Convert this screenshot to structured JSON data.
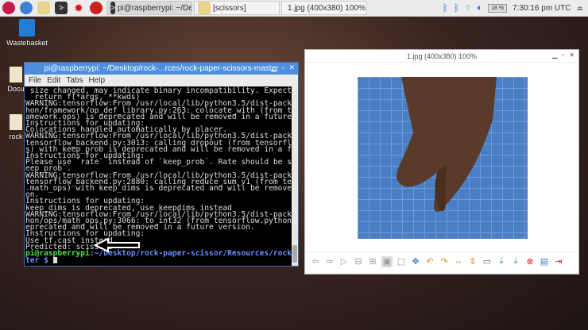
{
  "taskbar": {
    "tasks": [
      {
        "label": "pi@raspberrypi: ~/De..."
      },
      {
        "label": "[scissors]"
      },
      {
        "label": "1.jpg (400x380) 100%"
      }
    ],
    "cpu": "18 %",
    "clock": "7:30:16 pm UTC"
  },
  "desktop": {
    "icons": [
      {
        "label": "Wastebasket"
      },
      {
        "label": "Docu"
      },
      {
        "label": "rock"
      }
    ]
  },
  "terminal": {
    "title": "pi@raspberrypi: ~/Desktop/rock-...rces/rock-paper-scissors-master",
    "menu": [
      "File",
      "Edit",
      "Tabs",
      "Help"
    ],
    "lines": [
      " size changed, may indicate binary incompatibility. Expected 432, got 412",
      "  return f(*args, **kwds)",
      "WARNING:tensorflow:From /usr/local/lib/python3.5/dist-packages/tensorflow/pyt",
      "hon/framework/op_def_library.py:263: colocate_with (from tensorflow.python.fr",
      "amework.ops) is deprecated and will be removed in a future version.",
      "Instructions for updating:",
      "Colocations handled automatically by placer.",
      "WARNING:tensorflow:From /usr/local/lib/python3.5/dist-packages/keras/backend/",
      "tensorflow_backend.py:3013: calling dropout (from tensorflow.python.ops.nn_op",
      "s) with keep_prob is deprecated and will be removed in a future version.",
      "Instructions for updating:",
      "Please use `rate` instead of `keep_prob`. Rate should be set to `rate = 1 - k",
      "eep_prob`.",
      "WARNING:tensorflow:From /usr/local/lib/python3.5/dist-packages/keras/backend/",
      "tensorflow_backend.py:2880: calling reduce_sum_v1 (from tensorflow.python.ops",
      ".math_ops) with keep_dims is deprecated and will be removed in a future versi",
      "on.",
      "Instructions for updating:",
      "keep_dims is deprecated, use keepdims instead",
      "WARNING:tensorflow:From /usr/local/lib/python3.5/dist-packages/tensorflow/pyt",
      "hon/ops/math_ops.py:3066: to_int32 (from tensorflow.python.ops.math_ops) is d",
      "eprecated and will be removed in a future version.",
      "Instructions for updating:",
      "Use tf.cast instead.",
      "Predicted: scissors"
    ],
    "prompt_user": "pi@raspberrypi",
    "prompt_path": ":~/Desktop/rock-paper-scissor/Resources/rock-paper-scissors-mas",
    "prompt_path2": "ter $ "
  },
  "viewer": {
    "title": "1.jpg (400x380) 100%"
  }
}
